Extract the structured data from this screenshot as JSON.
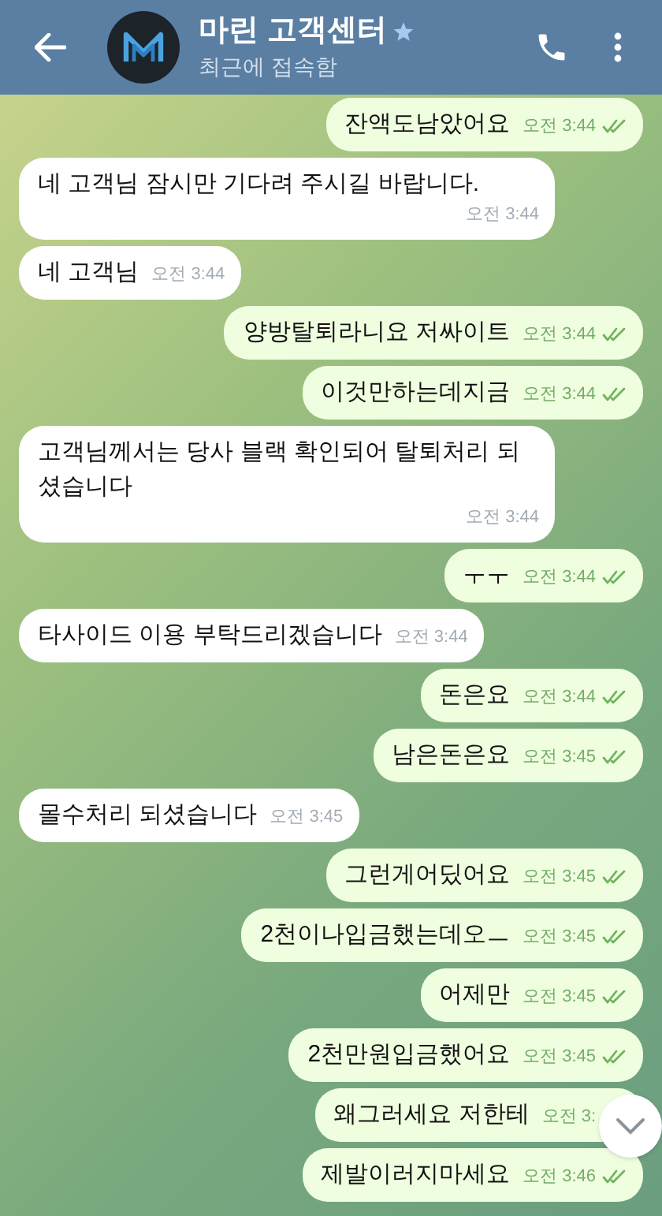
{
  "header": {
    "title": "마린 고객센터",
    "status": "최근에 접속함",
    "starred": true
  },
  "messages": [
    {
      "kind": "outgoing",
      "text": "잔액도남았어요",
      "time": "오전 3:44",
      "read": true
    },
    {
      "kind": "incoming",
      "text": "네 고객님 잠시만 기다려 주시길 바랍니다.",
      "time": "오전 3:44"
    },
    {
      "kind": "incoming",
      "text": "네 고객님",
      "time": "오전 3:44"
    },
    {
      "kind": "outgoing",
      "text": "양방탈퇴라니요 저싸이트",
      "time": "오전 3:44",
      "read": true
    },
    {
      "kind": "outgoing",
      "text": "이것만하는데지금",
      "time": "오전 3:44",
      "read": true
    },
    {
      "kind": "incoming",
      "text": "고객님께서는 당사 블랙 확인되어 탈퇴처리 되셨습니다",
      "time": "오전 3:44"
    },
    {
      "kind": "outgoing",
      "text": "ㅜㅜ",
      "time": "오전 3:44",
      "read": true
    },
    {
      "kind": "incoming",
      "text": "타사이드 이용 부탁드리겠습니다",
      "time": "오전 3:44"
    },
    {
      "kind": "outgoing",
      "text": "돈은요",
      "time": "오전 3:44",
      "read": true
    },
    {
      "kind": "outgoing",
      "text": "남은돈은요",
      "time": "오전 3:45",
      "read": true
    },
    {
      "kind": "incoming",
      "text": "몰수처리 되셨습니다",
      "time": "오전 3:45"
    },
    {
      "kind": "outgoing",
      "text": "그런게어딨어요",
      "time": "오전 3:45",
      "read": true
    },
    {
      "kind": "outgoing",
      "text": "2천이나입금했는데오ㅡ",
      "time": "오전 3:45",
      "read": true
    },
    {
      "kind": "outgoing",
      "text": "어제만",
      "time": "오전 3:45",
      "read": true
    },
    {
      "kind": "outgoing",
      "text": "2천만원입금했어요",
      "time": "오전 3:45",
      "read": true
    },
    {
      "kind": "outgoing",
      "text": "왜그러세요 저한테",
      "time": "오전 3:"
    },
    {
      "kind": "outgoing",
      "text": "제발이러지마세요",
      "time": "오전 3:46",
      "read": true
    }
  ]
}
